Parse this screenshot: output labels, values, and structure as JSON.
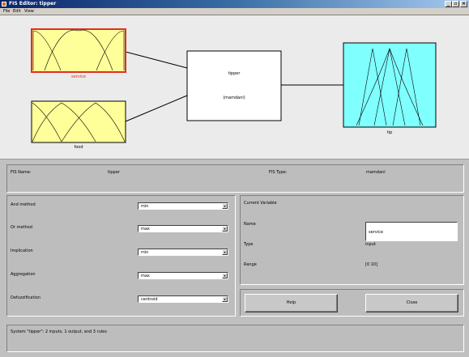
{
  "window": {
    "title": "FIS Editor: tipper"
  },
  "menu": {
    "items": [
      "File",
      "Edit",
      "View"
    ]
  },
  "diagram": {
    "inputs": [
      {
        "label": "service",
        "selected": true
      },
      {
        "label": "food",
        "selected": false
      }
    ],
    "system": {
      "name": "tipper",
      "type": "(mamdani)"
    },
    "output": {
      "label": "tip"
    }
  },
  "info": {
    "fis_name_label": "FIS Name:",
    "fis_name_value": "tipper",
    "fis_type_label": "FIS Type:",
    "fis_type_value": "mamdani"
  },
  "methods": [
    {
      "label": "And method",
      "value": "min"
    },
    {
      "label": "Or method",
      "value": "max"
    },
    {
      "label": "Implication",
      "value": "min"
    },
    {
      "label": "Aggregation",
      "value": "max"
    },
    {
      "label": "Defuzzification",
      "value": "centroid"
    }
  ],
  "current_variable": {
    "heading": "Current Variable",
    "name_label": "Name",
    "name_value": "service",
    "type_label": "Type",
    "type_value": "input",
    "range_label": "Range",
    "range_value": "[0 10]"
  },
  "buttons": {
    "help": "Help",
    "close": "Close"
  },
  "status": {
    "text": "System \"tipper\": 2 inputs, 1 output, and 3 rules"
  },
  "colors": {
    "input_fill": "#ffff99",
    "output_fill": "#80ffff",
    "selected_border": "#e03020"
  }
}
